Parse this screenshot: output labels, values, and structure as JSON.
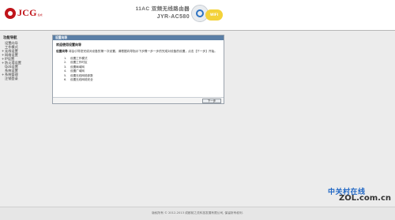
{
  "brand": {
    "name": "JCG",
    "sub": "集成"
  },
  "product": {
    "title": "11AC 双频无线路由器",
    "model": "JYR-AC580"
  },
  "badges": {
    "wifi_label": "WIFI"
  },
  "sidebar": {
    "title": "功能导航",
    "items": [
      {
        "label": "设置向导"
      },
      {
        "label": "工作模式"
      },
      {
        "label": "无线设置"
      },
      {
        "label": "网络设置"
      },
      {
        "label": "IP设置"
      },
      {
        "label": "防火墙设置"
      },
      {
        "label": "QoS设置"
      },
      {
        "label": "系统设置"
      },
      {
        "label": "系统管理"
      },
      {
        "label": "注销登录"
      }
    ]
  },
  "panel": {
    "header": "设置向导",
    "welcome": "欢迎使用设置向导",
    "intro_label": "设置向导",
    "intro_text": "将会引导您完成对设备的第一次设置，请根据向导指示下步骤一步一步的完成对设备的设置，点击【下一步】开始。",
    "steps": [
      {
        "num": "1.",
        "text": "设置工作模式"
      },
      {
        "num": "2.",
        "text": "设置工作时区"
      },
      {
        "num": "3.",
        "text": "设置局域网"
      },
      {
        "num": "4.",
        "text": "设置广域网"
      },
      {
        "num": "5.",
        "text": "设置无线网络参数"
      },
      {
        "num": "6.",
        "text": "设置无线网络安全"
      }
    ],
    "next_label": "下一步"
  },
  "footer": {
    "copyright": "版权所有 © 2012-2013 成都前之灵科技发展有限公司, 保留所有权利."
  },
  "watermark": {
    "text": "中关村在线",
    "url": "ZOL.com.cn"
  },
  "colors": {
    "accent": "#c0141a",
    "panel_header": "#5b7fa6",
    "wifi_badge": "#f3d23a"
  }
}
